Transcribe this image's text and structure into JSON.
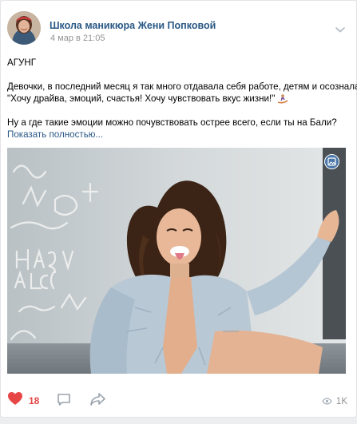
{
  "post": {
    "author": "Школа маникюра Жени Попковой",
    "date": "4 мар в 21:05",
    "text_lines": [
      "АГУНГ",
      "",
      "Девочки, в последний месяц я так много отдавала себя работе, детям и осознала:",
      "\"Хочу драйва, эмоций, счастья! Хочу чувствовать вкус жизни!\"",
      "",
      "Ну а где такие эмоции можно почувствовать острее всего, если ты на Бали?"
    ],
    "show_more": "Показать полностью...",
    "emoji": "surfer"
  },
  "actions": {
    "likes": "18",
    "views": "1K"
  },
  "colors": {
    "link": "#2a5885",
    "like": "#e64646",
    "muted": "#939393",
    "accent": "#4a76a8"
  },
  "icons": [
    "chevron-down-icon",
    "heart-icon",
    "comment-icon",
    "share-icon",
    "eye-icon",
    "photo-badge-icon"
  ]
}
